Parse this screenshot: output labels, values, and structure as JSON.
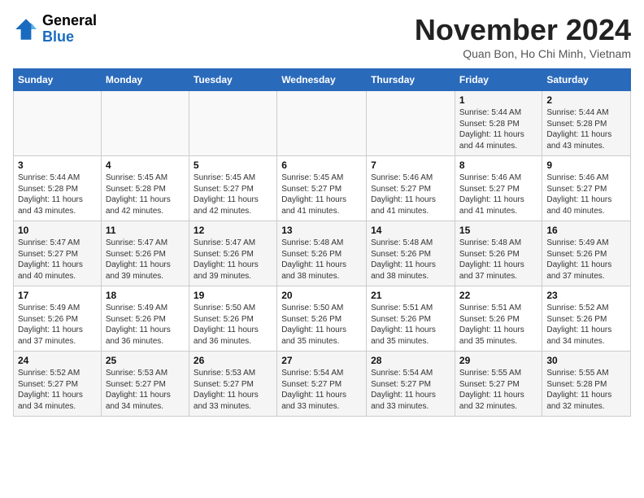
{
  "header": {
    "logo_general": "General",
    "logo_blue": "Blue",
    "month_title": "November 2024",
    "location": "Quan Bon, Ho Chi Minh, Vietnam"
  },
  "calendar": {
    "days_of_week": [
      "Sunday",
      "Monday",
      "Tuesday",
      "Wednesday",
      "Thursday",
      "Friday",
      "Saturday"
    ],
    "weeks": [
      [
        {
          "day": "",
          "info": ""
        },
        {
          "day": "",
          "info": ""
        },
        {
          "day": "",
          "info": ""
        },
        {
          "day": "",
          "info": ""
        },
        {
          "day": "",
          "info": ""
        },
        {
          "day": "1",
          "info": "Sunrise: 5:44 AM\nSunset: 5:28 PM\nDaylight: 11 hours\nand 44 minutes."
        },
        {
          "day": "2",
          "info": "Sunrise: 5:44 AM\nSunset: 5:28 PM\nDaylight: 11 hours\nand 43 minutes."
        }
      ],
      [
        {
          "day": "3",
          "info": "Sunrise: 5:44 AM\nSunset: 5:28 PM\nDaylight: 11 hours\nand 43 minutes."
        },
        {
          "day": "4",
          "info": "Sunrise: 5:45 AM\nSunset: 5:28 PM\nDaylight: 11 hours\nand 42 minutes."
        },
        {
          "day": "5",
          "info": "Sunrise: 5:45 AM\nSunset: 5:27 PM\nDaylight: 11 hours\nand 42 minutes."
        },
        {
          "day": "6",
          "info": "Sunrise: 5:45 AM\nSunset: 5:27 PM\nDaylight: 11 hours\nand 41 minutes."
        },
        {
          "day": "7",
          "info": "Sunrise: 5:46 AM\nSunset: 5:27 PM\nDaylight: 11 hours\nand 41 minutes."
        },
        {
          "day": "8",
          "info": "Sunrise: 5:46 AM\nSunset: 5:27 PM\nDaylight: 11 hours\nand 41 minutes."
        },
        {
          "day": "9",
          "info": "Sunrise: 5:46 AM\nSunset: 5:27 PM\nDaylight: 11 hours\nand 40 minutes."
        }
      ],
      [
        {
          "day": "10",
          "info": "Sunrise: 5:47 AM\nSunset: 5:27 PM\nDaylight: 11 hours\nand 40 minutes."
        },
        {
          "day": "11",
          "info": "Sunrise: 5:47 AM\nSunset: 5:26 PM\nDaylight: 11 hours\nand 39 minutes."
        },
        {
          "day": "12",
          "info": "Sunrise: 5:47 AM\nSunset: 5:26 PM\nDaylight: 11 hours\nand 39 minutes."
        },
        {
          "day": "13",
          "info": "Sunrise: 5:48 AM\nSunset: 5:26 PM\nDaylight: 11 hours\nand 38 minutes."
        },
        {
          "day": "14",
          "info": "Sunrise: 5:48 AM\nSunset: 5:26 PM\nDaylight: 11 hours\nand 38 minutes."
        },
        {
          "day": "15",
          "info": "Sunrise: 5:48 AM\nSunset: 5:26 PM\nDaylight: 11 hours\nand 37 minutes."
        },
        {
          "day": "16",
          "info": "Sunrise: 5:49 AM\nSunset: 5:26 PM\nDaylight: 11 hours\nand 37 minutes."
        }
      ],
      [
        {
          "day": "17",
          "info": "Sunrise: 5:49 AM\nSunset: 5:26 PM\nDaylight: 11 hours\nand 37 minutes."
        },
        {
          "day": "18",
          "info": "Sunrise: 5:49 AM\nSunset: 5:26 PM\nDaylight: 11 hours\nand 36 minutes."
        },
        {
          "day": "19",
          "info": "Sunrise: 5:50 AM\nSunset: 5:26 PM\nDaylight: 11 hours\nand 36 minutes."
        },
        {
          "day": "20",
          "info": "Sunrise: 5:50 AM\nSunset: 5:26 PM\nDaylight: 11 hours\nand 35 minutes."
        },
        {
          "day": "21",
          "info": "Sunrise: 5:51 AM\nSunset: 5:26 PM\nDaylight: 11 hours\nand 35 minutes."
        },
        {
          "day": "22",
          "info": "Sunrise: 5:51 AM\nSunset: 5:26 PM\nDaylight: 11 hours\nand 35 minutes."
        },
        {
          "day": "23",
          "info": "Sunrise: 5:52 AM\nSunset: 5:26 PM\nDaylight: 11 hours\nand 34 minutes."
        }
      ],
      [
        {
          "day": "24",
          "info": "Sunrise: 5:52 AM\nSunset: 5:27 PM\nDaylight: 11 hours\nand 34 minutes."
        },
        {
          "day": "25",
          "info": "Sunrise: 5:53 AM\nSunset: 5:27 PM\nDaylight: 11 hours\nand 34 minutes."
        },
        {
          "day": "26",
          "info": "Sunrise: 5:53 AM\nSunset: 5:27 PM\nDaylight: 11 hours\nand 33 minutes."
        },
        {
          "day": "27",
          "info": "Sunrise: 5:54 AM\nSunset: 5:27 PM\nDaylight: 11 hours\nand 33 minutes."
        },
        {
          "day": "28",
          "info": "Sunrise: 5:54 AM\nSunset: 5:27 PM\nDaylight: 11 hours\nand 33 minutes."
        },
        {
          "day": "29",
          "info": "Sunrise: 5:55 AM\nSunset: 5:27 PM\nDaylight: 11 hours\nand 32 minutes."
        },
        {
          "day": "30",
          "info": "Sunrise: 5:55 AM\nSunset: 5:28 PM\nDaylight: 11 hours\nand 32 minutes."
        }
      ]
    ]
  }
}
